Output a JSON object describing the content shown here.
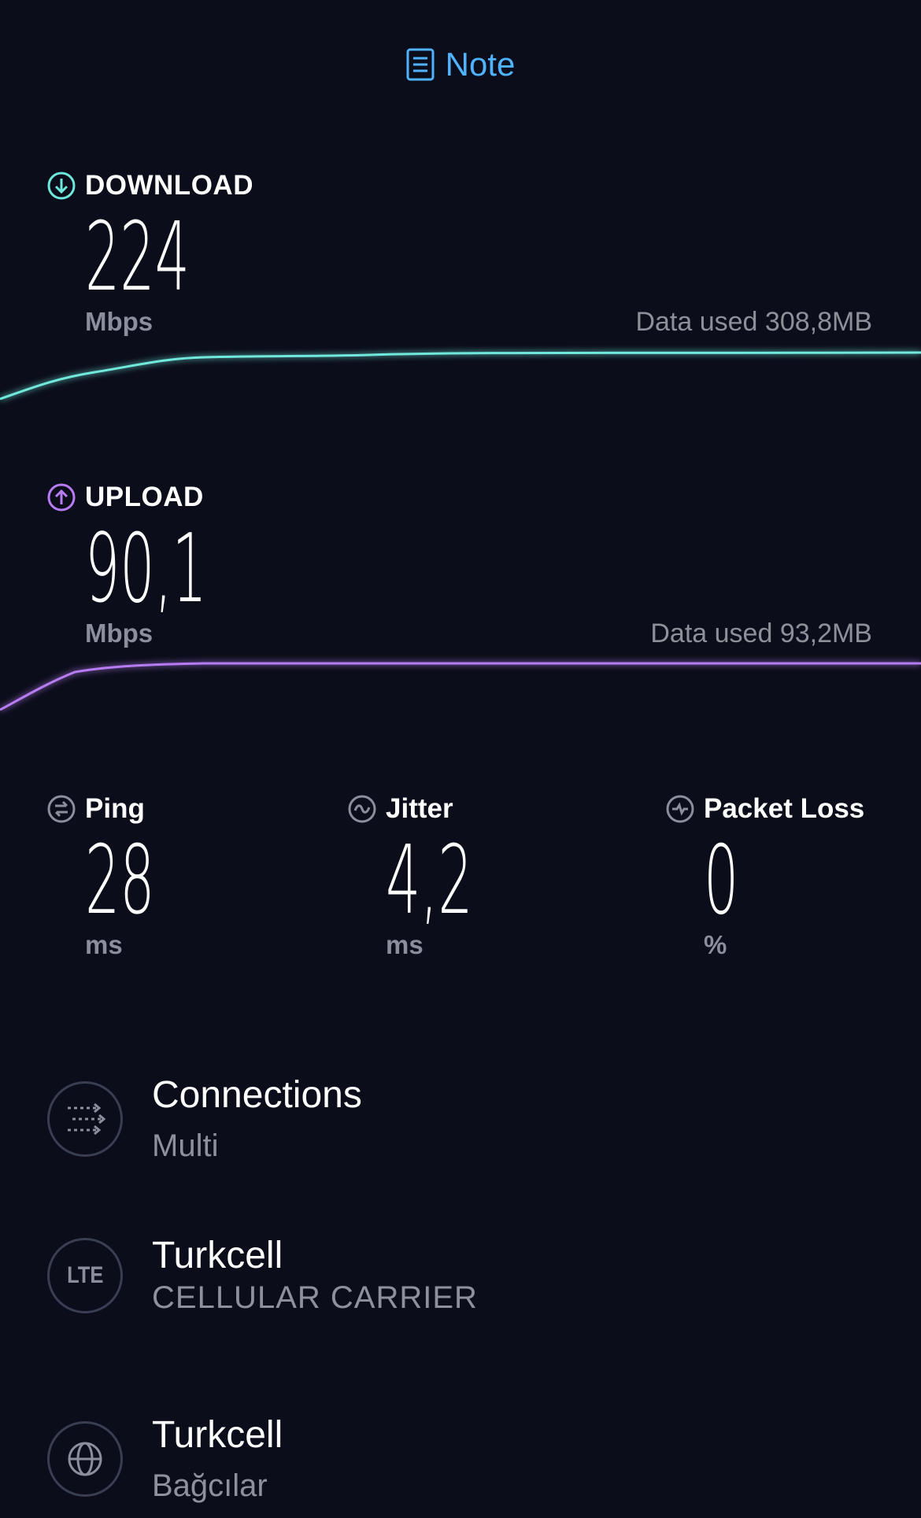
{
  "header": {
    "note_label": "Note",
    "note_icon": "document-icon",
    "accent": "#4fb3ff"
  },
  "download": {
    "title": "DOWNLOAD",
    "icon": "download-arrow-icon",
    "value": "224",
    "unit": "Mbps",
    "data_used": "Data used 308,8MB",
    "color": "#6fe8dc"
  },
  "upload": {
    "title": "UPLOAD",
    "icon": "upload-arrow-icon",
    "value": "90,1",
    "unit": "Mbps",
    "data_used": "Data used 93,2MB",
    "color": "#b77cf2"
  },
  "metrics": [
    {
      "title": "Ping",
      "icon": "ping-icon",
      "value": "28",
      "unit": "ms"
    },
    {
      "title": "Jitter",
      "icon": "jitter-icon",
      "value": "4,2",
      "unit": "ms"
    },
    {
      "title": "Packet Loss",
      "icon": "packet-loss-icon",
      "value": "0",
      "unit": "%"
    }
  ],
  "details": [
    {
      "title": "Connections",
      "subtitle": "Multi",
      "icon": "connections-icon"
    },
    {
      "title": "Turkcell",
      "subtitle": "CELLULAR CARRIER",
      "icon": "lte-icon",
      "icon_text": "LTE"
    },
    {
      "title": "Turkcell",
      "subtitle": "Bağcılar",
      "icon": "globe-icon"
    }
  ]
}
